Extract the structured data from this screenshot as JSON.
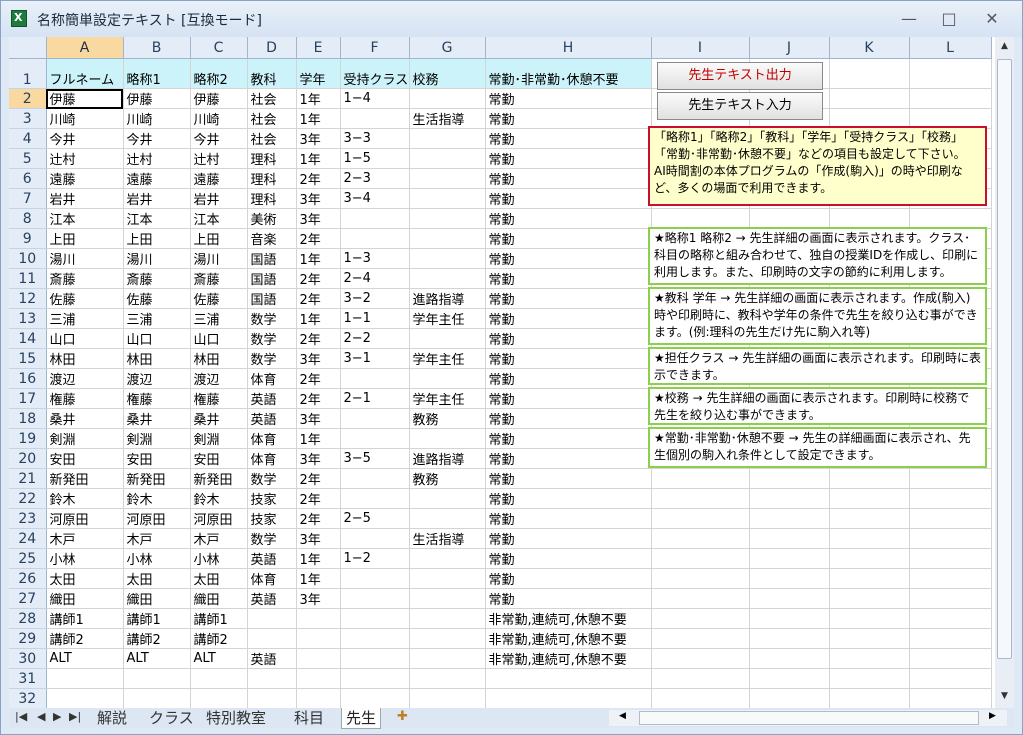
{
  "window": {
    "title": "名称簡単設定テキスト  [互換モード]",
    "minimize": "—",
    "maximize": "□",
    "close": "✕"
  },
  "columns": [
    "A",
    "B",
    "C",
    "D",
    "E",
    "F",
    "G",
    "H",
    "I",
    "J",
    "K",
    "L"
  ],
  "rows": [
    [
      "フルネーム",
      "略称1",
      "略称2",
      "教科",
      "学年",
      "受持クラス",
      "校務",
      "常勤･非常勤･休憩不要"
    ],
    [
      "伊藤",
      "伊藤",
      "伊藤",
      "社会",
      "1年",
      "1−4",
      "",
      "常勤"
    ],
    [
      "川崎",
      "川崎",
      "川崎",
      "社会",
      "1年",
      "",
      "生活指導",
      "常勤"
    ],
    [
      "今井",
      "今井",
      "今井",
      "社会",
      "3年",
      "3−3",
      "",
      "常勤"
    ],
    [
      "辻村",
      "辻村",
      "辻村",
      "理科",
      "1年",
      "1−5",
      "",
      "常勤"
    ],
    [
      "遠藤",
      "遠藤",
      "遠藤",
      "理科",
      "2年",
      "2−3",
      "",
      "常勤"
    ],
    [
      "岩井",
      "岩井",
      "岩井",
      "理科",
      "3年",
      "3−4",
      "",
      "常勤"
    ],
    [
      "江本",
      "江本",
      "江本",
      "美術",
      "3年",
      "",
      "",
      "常勤"
    ],
    [
      "上田",
      "上田",
      "上田",
      "音楽",
      "2年",
      "",
      "",
      "常勤"
    ],
    [
      "湯川",
      "湯川",
      "湯川",
      "国語",
      "1年",
      "1−3",
      "",
      "常勤"
    ],
    [
      "斎藤",
      "斎藤",
      "斎藤",
      "国語",
      "2年",
      "2−4",
      "",
      "常勤"
    ],
    [
      "佐藤",
      "佐藤",
      "佐藤",
      "国語",
      "2年",
      "3−2",
      "進路指導",
      "常勤"
    ],
    [
      "三浦",
      "三浦",
      "三浦",
      "数学",
      "1年",
      "1−1",
      "学年主任",
      "常勤"
    ],
    [
      "山口",
      "山口",
      "山口",
      "数学",
      "2年",
      "2−2",
      "",
      "常勤"
    ],
    [
      "林田",
      "林田",
      "林田",
      "数学",
      "3年",
      "3−1",
      "学年主任",
      "常勤"
    ],
    [
      "渡辺",
      "渡辺",
      "渡辺",
      "体育",
      "2年",
      "",
      "",
      "常勤"
    ],
    [
      "権藤",
      "権藤",
      "権藤",
      "英語",
      "2年",
      "2−1",
      "学年主任",
      "常勤"
    ],
    [
      "桑井",
      "桑井",
      "桑井",
      "英語",
      "3年",
      "",
      "教務",
      "常勤"
    ],
    [
      "剣淵",
      "剣淵",
      "剣淵",
      "体育",
      "1年",
      "",
      "",
      "常勤"
    ],
    [
      "安田",
      "安田",
      "安田",
      "体育",
      "3年",
      "3−5",
      "進路指導",
      "常勤"
    ],
    [
      "新発田",
      "新発田",
      "新発田",
      "数学",
      "2年",
      "",
      "教務",
      "常勤"
    ],
    [
      "鈴木",
      "鈴木",
      "鈴木",
      "技家",
      "2年",
      "",
      "",
      "常勤"
    ],
    [
      "河原田",
      "河原田",
      "河原田",
      "技家",
      "2年",
      "2−5",
      "",
      "常勤"
    ],
    [
      "木戸",
      "木戸",
      "木戸",
      "数学",
      "3年",
      "",
      "生活指導",
      "常勤"
    ],
    [
      "小林",
      "小林",
      "小林",
      "英語",
      "1年",
      "1−2",
      "",
      "常勤"
    ],
    [
      "太田",
      "太田",
      "太田",
      "体育",
      "1年",
      "",
      "",
      "常勤"
    ],
    [
      "織田",
      "織田",
      "織田",
      "英語",
      "3年",
      "",
      "",
      "常勤"
    ],
    [
      "講師1",
      "講師1",
      "講師1",
      "",
      "",
      "",
      "",
      "非常勤,連続可,休憩不要"
    ],
    [
      "講師2",
      "講師2",
      "講師2",
      "",
      "",
      "",
      "",
      "非常勤,連続可,休憩不要"
    ],
    [
      "ALT",
      "ALT",
      "ALT",
      "英語",
      "",
      "",
      "",
      "非常勤,連続可,休憩不要"
    ],
    [
      "",
      "",
      "",
      "",
      "",
      "",
      "",
      ""
    ],
    [
      "",
      "",
      "",
      "",
      "",
      "",
      "",
      ""
    ]
  ],
  "buttons": {
    "export": "先生テキスト出力",
    "import": "先生テキスト入力"
  },
  "notes": [
    "「略称1」「略称2」「教科」「学年」「受持クラス」「校務」「常勤･非常勤･休憩不要」などの項目も設定して下さい。 AI時間割の本体プログラムの「作成(駒入)」の時や印刷など、多くの場面で利用できます。",
    "★略称1 略称2 → 先生詳細の画面に表示されます。クラス･科目の略称と組み合わせて、独自の授業IDを作成し、印刷に利用します。また、印刷時の文字の節約に利用します。",
    "★教科 学年 → 先生詳細の画面に表示されます。作成(駒入)時や印刷時に、教科や学年の条件で先生を絞り込む事ができます。(例:理科の先生だけ先に駒入れ等)",
    "★担任クラス → 先生詳細の画面に表示されます。印刷時に表示できます。",
    "★校務 → 先生詳細の画面に表示されます。印刷時に校務で先生を絞り込む事ができます。",
    "★常勤･非常勤･休憩不要 → 先生の詳細画面に表示され、先生個別の駒入れ条件として設定できます。"
  ],
  "tabs": [
    "解説",
    "クラス",
    "特別教室",
    "科目",
    "先生"
  ],
  "active_tab": "先生",
  "active_cell": "A2",
  "colors": {
    "header_fill": "#ccf3fa",
    "selected_header": "#f9d99f",
    "button_text": "#c00000",
    "note_red_border": "#c8102e",
    "note_green_border": "#8ccf4d"
  }
}
